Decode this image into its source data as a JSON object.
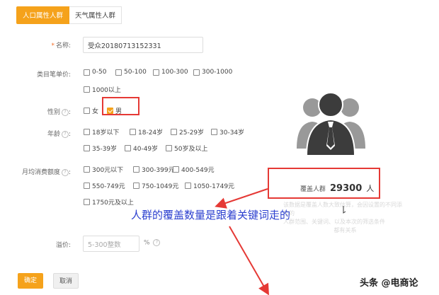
{
  "tabs": {
    "active": "人口属性人群",
    "inactive": "天气属性人群"
  },
  "name_field": {
    "label": "名称:",
    "value": "受众20180713152331"
  },
  "category_price": {
    "label": "类目笔单价:",
    "options": [
      "0-50",
      "50-100",
      "100-300",
      "300-1000",
      "1000以上"
    ]
  },
  "gender": {
    "label": "性别",
    "options": [
      "女",
      "男"
    ],
    "checked": "男"
  },
  "age": {
    "label": "年龄",
    "options": [
      "18岁以下",
      "18-24岁",
      "25-29岁",
      "30-34岁",
      "35-39岁",
      "40-49岁",
      "50岁及以上"
    ]
  },
  "monthly_spend": {
    "label": "月均消费额度",
    "options": [
      "300元以下",
      "300-399元",
      "400-549元",
      "550-749元",
      "750-1049元",
      "1050-1749元",
      "1750元及以上"
    ]
  },
  "premium": {
    "label": "溢价:",
    "placeholder": "5-300整数",
    "unit": "%"
  },
  "buttons": {
    "confirm": "确定",
    "cancel": "取消"
  },
  "coverage": {
    "label": "覆盖人群",
    "value": "29300",
    "unit": "人"
  },
  "faint_text": {
    "line1": "该数据是覆盖人数大致估算，会因设置的不同添加的",
    "line2": "人群范围、关键词、以及本次的筛选条件",
    "line3": "都有关系"
  },
  "annotation": "人群的覆盖数量是跟着关键词走的",
  "watermark": "头条 @电商论",
  "colors": {
    "accent": "#f5a21b",
    "annotation_red": "#e53935",
    "annotation_blue": "#2b3fcf"
  },
  "icons": {
    "audience": "people-group-icon",
    "help": "question-icon"
  }
}
